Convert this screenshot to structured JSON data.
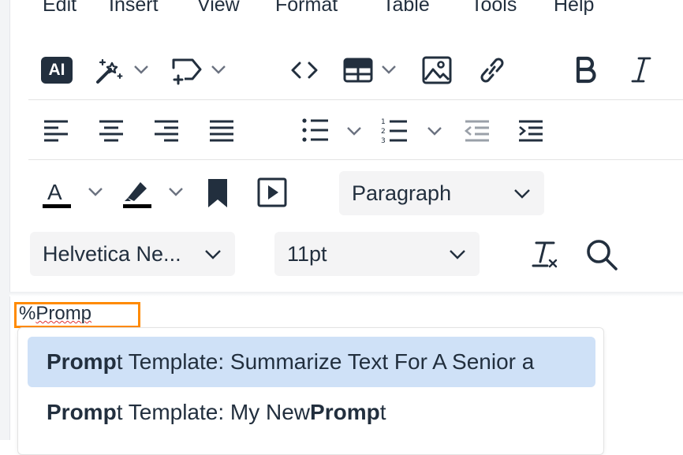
{
  "menubar": {
    "items": [
      "Edit",
      "Insert",
      "View",
      "Format",
      "Table",
      "Tools",
      "Help"
    ]
  },
  "toolbar": {
    "ai_label": "AI",
    "block_format": "Paragraph",
    "font_family": "Helvetica Ne...",
    "font_size": "11pt"
  },
  "editor": {
    "typed_prefix": "%",
    "typed_word": "Promp"
  },
  "autocomplete": {
    "items": [
      {
        "bold": "Promp",
        "rest": "t Template: Summarize Text For A Senior a",
        "selected": true
      },
      {
        "bold": "Promp",
        "rest": "t Template: My New ",
        "bold2": "Promp",
        "rest2": "t",
        "selected": false
      }
    ]
  },
  "colors": {
    "accent_focus": "#ff8a00",
    "selection": "#cfe1f7",
    "icon": "#222f3e"
  }
}
